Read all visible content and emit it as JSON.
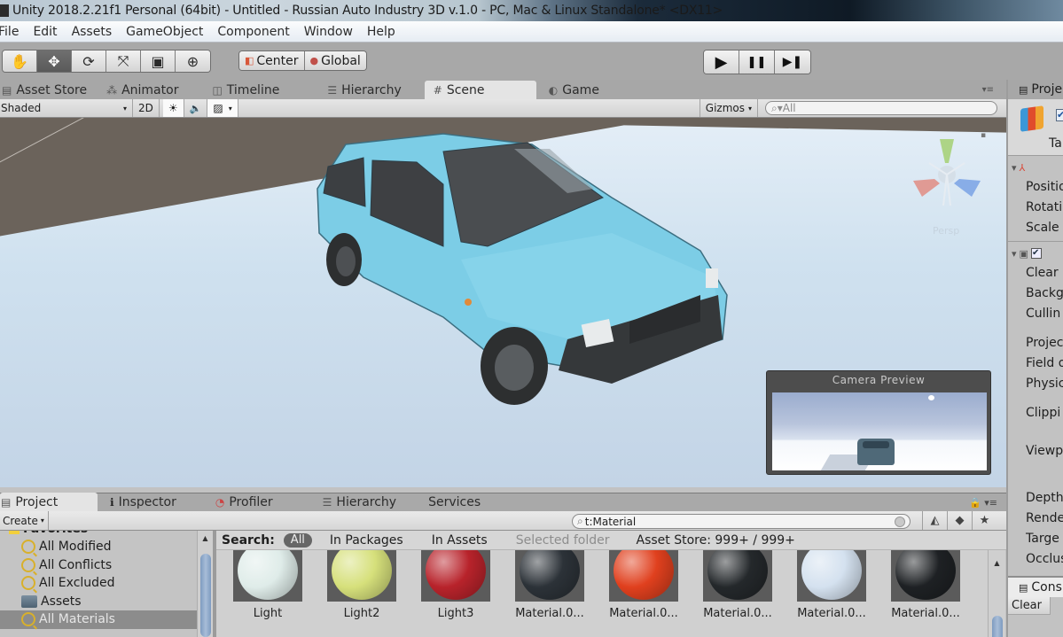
{
  "window": {
    "title": "Unity 2018.2.21f1 Personal (64bit) - Untitled - Russian Auto Industry 3D v.1.0 - PC, Mac & Linux Standalone* <DX11>"
  },
  "menu": [
    "File",
    "Edit",
    "Assets",
    "GameObject",
    "Component",
    "Window",
    "Help"
  ],
  "toolbar": {
    "tools": [
      {
        "name": "hand-tool",
        "glyph": "✋",
        "active": false
      },
      {
        "name": "move-tool",
        "glyph": "✥",
        "active": true
      },
      {
        "name": "rotate-tool",
        "glyph": "⟳",
        "active": false
      },
      {
        "name": "scale-tool",
        "glyph": "⤧",
        "active": false
      },
      {
        "name": "rect-tool",
        "glyph": "▣",
        "active": false
      },
      {
        "name": "transform-tool",
        "glyph": "⊕",
        "active": false
      }
    ],
    "pivot_mode": "Center",
    "pivot_rotation": "Global",
    "play": "▶",
    "pause": "❚❚",
    "step": "▶❚"
  },
  "scene_tabs": [
    {
      "label": "Asset Store",
      "icon": "▤"
    },
    {
      "label": "Animator",
      "icon": "⁂"
    },
    {
      "label": "Timeline",
      "icon": "◫"
    },
    {
      "label": "Hierarchy",
      "icon": "☰"
    },
    {
      "label": "Scene",
      "icon": "#",
      "active": true
    },
    {
      "label": "Game",
      "icon": "◐"
    }
  ],
  "scene_toolbar": {
    "draw_mode": "Shaded",
    "mode_2d": "2D",
    "lighting_icon": "☀",
    "audio_icon": "🔈",
    "effects_icon": "▨",
    "gizmos": "Gizmos",
    "search_placeholder": "All"
  },
  "scene_view": {
    "gizmo_label": "Persp",
    "camera_preview_title": "Camera Preview"
  },
  "inspector": {
    "tab_label": "Proje",
    "tag_label": "Ta",
    "transform_fields": [
      "Positio",
      "Rotati",
      "Scale"
    ],
    "camera_fields": [
      "Clear",
      "Backg",
      "Cullin",
      "Projec",
      "Field o",
      "Physic",
      "Clippi",
      "Viewp",
      "Depth",
      "Rende",
      "Targe",
      "Occlus"
    ],
    "console_tab": "Cons",
    "console_clear": "Clear"
  },
  "project_panel": {
    "tabs": [
      {
        "label": "Project",
        "icon": "▤",
        "active": true
      },
      {
        "label": "Inspector",
        "icon": "ℹ"
      },
      {
        "label": "Profiler",
        "icon": "◔"
      },
      {
        "label": "Hierarchy",
        "icon": "☰"
      },
      {
        "label": "Services",
        "icon": ""
      }
    ],
    "create_label": "Create",
    "search_value": "t:Material",
    "tree": {
      "root": "Favorites",
      "items": [
        {
          "label": "All Modified",
          "type": "search"
        },
        {
          "label": "All Conflicts",
          "type": "search"
        },
        {
          "label": "All Excluded",
          "type": "search"
        },
        {
          "label": "Assets",
          "type": "folder"
        },
        {
          "label": "All Materials",
          "type": "search",
          "selected": true
        }
      ]
    },
    "search_filter": {
      "label": "Search:",
      "all": "All",
      "in_packages": "In Packages",
      "in_assets": "In Assets",
      "selected_folder": "Selected folder",
      "asset_store": "Asset Store: 999+ / 999+"
    },
    "assets": [
      {
        "name": "Light",
        "color": "#dfece9"
      },
      {
        "name": "Light2",
        "color": "#d6e07b"
      },
      {
        "name": "Light3",
        "color": "#b8232b"
      },
      {
        "name": "Material.0...",
        "color": "#2c3238"
      },
      {
        "name": "Material.0...",
        "color": "#e0401e"
      },
      {
        "name": "Material.0...",
        "color": "#24282b"
      },
      {
        "name": "Material.0...",
        "color": "#d4e1ef"
      },
      {
        "name": "Material.0...",
        "color": "#1e2124"
      }
    ]
  }
}
